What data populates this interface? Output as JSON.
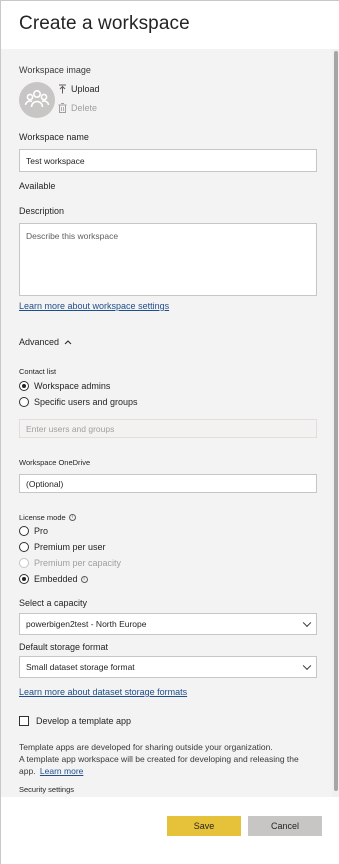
{
  "dialog": {
    "title": "Create a workspace"
  },
  "workspace_image": {
    "label": "Workspace image",
    "upload_label": "Upload",
    "delete_label": "Delete"
  },
  "workspace_name": {
    "label": "Workspace name",
    "value": "Test workspace",
    "status": "Available"
  },
  "description": {
    "label": "Description",
    "placeholder": "Describe this workspace"
  },
  "links": {
    "workspace_settings": "Learn more about workspace settings",
    "storage_formats": "Learn more about dataset storage formats",
    "learn_more": "Learn more"
  },
  "advanced": {
    "label": "Advanced"
  },
  "contact_list": {
    "label": "Contact list",
    "options": [
      "Workspace admins",
      "Specific users and groups"
    ],
    "selected": "Workspace admins",
    "users_placeholder": "Enter users and groups"
  },
  "onedrive": {
    "label": "Workspace OneDrive",
    "placeholder": "(Optional)"
  },
  "license_mode": {
    "label": "License mode",
    "options": [
      "Pro",
      "Premium per user",
      "Premium per capacity",
      "Embedded"
    ],
    "selected": "Embedded"
  },
  "capacity": {
    "label": "Select a capacity",
    "value": "powerbigen2test - North Europe"
  },
  "storage_format": {
    "label": "Default storage format",
    "value": "Small dataset storage format"
  },
  "template_app": {
    "checkbox_label": "Develop a template app",
    "description_line1": "Template apps are developed for sharing outside your organization.",
    "description_line2": "A template app workspace will be created for developing and releasing the",
    "description_line3": "app."
  },
  "security": {
    "label": "Security settings"
  },
  "buttons": {
    "save": "Save",
    "cancel": "Cancel"
  },
  "colors": {
    "primary_button": "#e6c23a",
    "link": "#1e4e8c",
    "panel_bg": "#f3f3f3"
  }
}
